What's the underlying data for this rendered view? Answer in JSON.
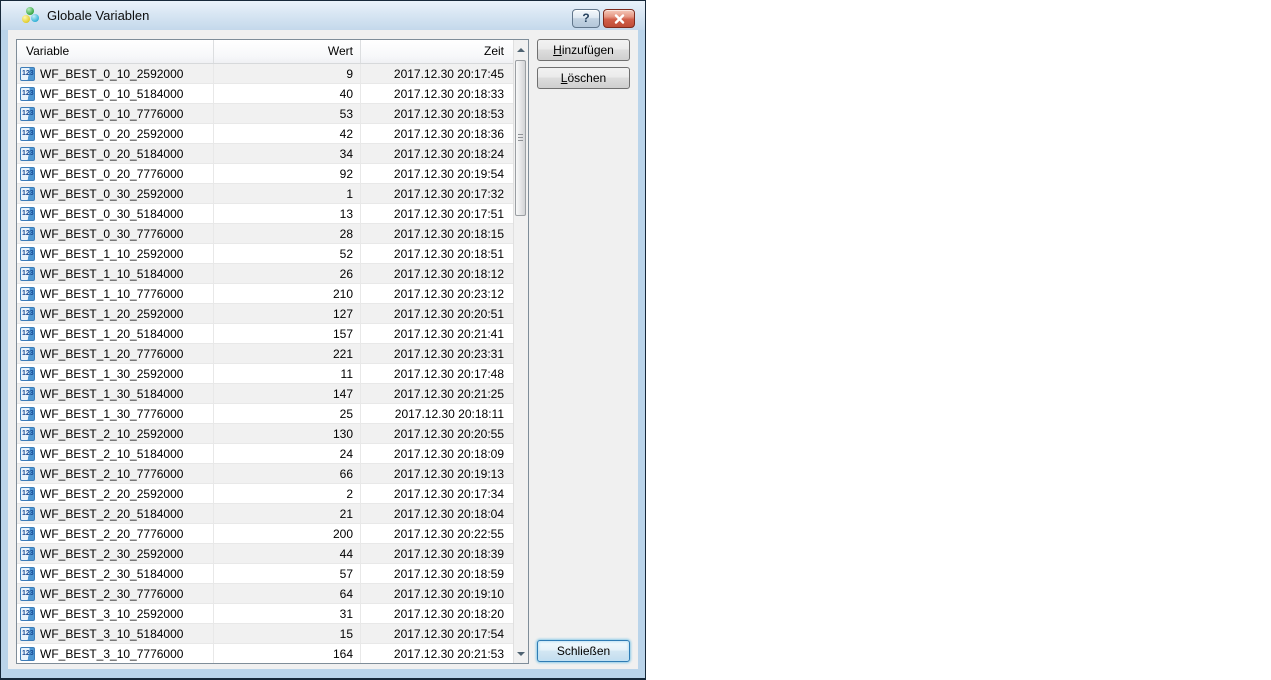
{
  "window": {
    "title": "Globale Variablen",
    "help_label": "?",
    "icon": "global-variables-icon"
  },
  "table": {
    "columns": [
      "Variable",
      "Wert",
      "Zeit"
    ],
    "row_icon_label": "123",
    "rows": [
      [
        "WF_BEST_0_10_2592000",
        "9",
        "2017.12.30 20:17:45"
      ],
      [
        "WF_BEST_0_10_5184000",
        "40",
        "2017.12.30 20:18:33"
      ],
      [
        "WF_BEST_0_10_7776000",
        "53",
        "2017.12.30 20:18:53"
      ],
      [
        "WF_BEST_0_20_2592000",
        "42",
        "2017.12.30 20:18:36"
      ],
      [
        "WF_BEST_0_20_5184000",
        "34",
        "2017.12.30 20:18:24"
      ],
      [
        "WF_BEST_0_20_7776000",
        "92",
        "2017.12.30 20:19:54"
      ],
      [
        "WF_BEST_0_30_2592000",
        "1",
        "2017.12.30 20:17:32"
      ],
      [
        "WF_BEST_0_30_5184000",
        "13",
        "2017.12.30 20:17:51"
      ],
      [
        "WF_BEST_0_30_7776000",
        "28",
        "2017.12.30 20:18:15"
      ],
      [
        "WF_BEST_1_10_2592000",
        "52",
        "2017.12.30 20:18:51"
      ],
      [
        "WF_BEST_1_10_5184000",
        "26",
        "2017.12.30 20:18:12"
      ],
      [
        "WF_BEST_1_10_7776000",
        "210",
        "2017.12.30 20:23:12"
      ],
      [
        "WF_BEST_1_20_2592000",
        "127",
        "2017.12.30 20:20:51"
      ],
      [
        "WF_BEST_1_20_5184000",
        "157",
        "2017.12.30 20:21:41"
      ],
      [
        "WF_BEST_1_20_7776000",
        "221",
        "2017.12.30 20:23:31"
      ],
      [
        "WF_BEST_1_30_2592000",
        "11",
        "2017.12.30 20:17:48"
      ],
      [
        "WF_BEST_1_30_5184000",
        "147",
        "2017.12.30 20:21:25"
      ],
      [
        "WF_BEST_1_30_7776000",
        "25",
        "2017.12.30 20:18:11"
      ],
      [
        "WF_BEST_2_10_2592000",
        "130",
        "2017.12.30 20:20:55"
      ],
      [
        "WF_BEST_2_10_5184000",
        "24",
        "2017.12.30 20:18:09"
      ],
      [
        "WF_BEST_2_10_7776000",
        "66",
        "2017.12.30 20:19:13"
      ],
      [
        "WF_BEST_2_20_2592000",
        "2",
        "2017.12.30 20:17:34"
      ],
      [
        "WF_BEST_2_20_5184000",
        "21",
        "2017.12.30 20:18:04"
      ],
      [
        "WF_BEST_2_20_7776000",
        "200",
        "2017.12.30 20:22:55"
      ],
      [
        "WF_BEST_2_30_2592000",
        "44",
        "2017.12.30 20:18:39"
      ],
      [
        "WF_BEST_2_30_5184000",
        "57",
        "2017.12.30 20:18:59"
      ],
      [
        "WF_BEST_2_30_7776000",
        "64",
        "2017.12.30 20:19:10"
      ],
      [
        "WF_BEST_3_10_2592000",
        "31",
        "2017.12.30 20:18:20"
      ],
      [
        "WF_BEST_3_10_5184000",
        "15",
        "2017.12.30 20:17:54"
      ],
      [
        "WF_BEST_3_10_7776000",
        "164",
        "2017.12.30 20:21:53"
      ]
    ]
  },
  "buttons": {
    "add": "Hinzufügen",
    "delete": "Löschen",
    "close": "Schließen"
  },
  "colors": {
    "titlebar_gradient_top": "#eaf3fb",
    "titlebar_gradient_bottom": "#c4d8eb",
    "window_frame_blue": "#bad4ea",
    "close_button_red": "#c9543d",
    "row_alt_gray": "#f1f1f1",
    "default_button_border_blue": "#2f7cb5"
  }
}
